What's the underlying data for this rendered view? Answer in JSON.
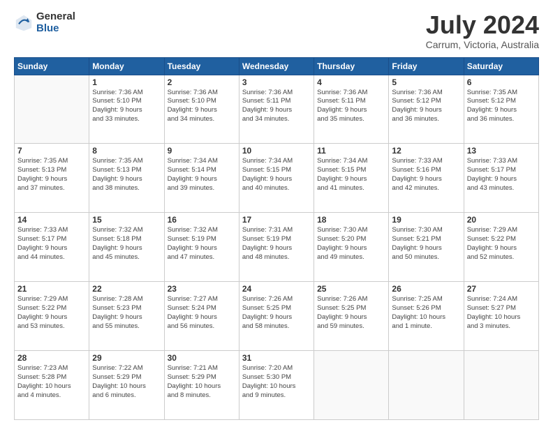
{
  "header": {
    "logo_general": "General",
    "logo_blue": "Blue",
    "title": "July 2024",
    "location": "Carrum, Victoria, Australia"
  },
  "weekdays": [
    "Sunday",
    "Monday",
    "Tuesday",
    "Wednesday",
    "Thursday",
    "Friday",
    "Saturday"
  ],
  "weeks": [
    [
      {
        "day": "",
        "info": ""
      },
      {
        "day": "1",
        "info": "Sunrise: 7:36 AM\nSunset: 5:10 PM\nDaylight: 9 hours\nand 33 minutes."
      },
      {
        "day": "2",
        "info": "Sunrise: 7:36 AM\nSunset: 5:10 PM\nDaylight: 9 hours\nand 34 minutes."
      },
      {
        "day": "3",
        "info": "Sunrise: 7:36 AM\nSunset: 5:11 PM\nDaylight: 9 hours\nand 34 minutes."
      },
      {
        "day": "4",
        "info": "Sunrise: 7:36 AM\nSunset: 5:11 PM\nDaylight: 9 hours\nand 35 minutes."
      },
      {
        "day": "5",
        "info": "Sunrise: 7:36 AM\nSunset: 5:12 PM\nDaylight: 9 hours\nand 36 minutes."
      },
      {
        "day": "6",
        "info": "Sunrise: 7:35 AM\nSunset: 5:12 PM\nDaylight: 9 hours\nand 36 minutes."
      }
    ],
    [
      {
        "day": "7",
        "info": "Sunrise: 7:35 AM\nSunset: 5:13 PM\nDaylight: 9 hours\nand 37 minutes."
      },
      {
        "day": "8",
        "info": "Sunrise: 7:35 AM\nSunset: 5:13 PM\nDaylight: 9 hours\nand 38 minutes."
      },
      {
        "day": "9",
        "info": "Sunrise: 7:34 AM\nSunset: 5:14 PM\nDaylight: 9 hours\nand 39 minutes."
      },
      {
        "day": "10",
        "info": "Sunrise: 7:34 AM\nSunset: 5:15 PM\nDaylight: 9 hours\nand 40 minutes."
      },
      {
        "day": "11",
        "info": "Sunrise: 7:34 AM\nSunset: 5:15 PM\nDaylight: 9 hours\nand 41 minutes."
      },
      {
        "day": "12",
        "info": "Sunrise: 7:33 AM\nSunset: 5:16 PM\nDaylight: 9 hours\nand 42 minutes."
      },
      {
        "day": "13",
        "info": "Sunrise: 7:33 AM\nSunset: 5:17 PM\nDaylight: 9 hours\nand 43 minutes."
      }
    ],
    [
      {
        "day": "14",
        "info": "Sunrise: 7:33 AM\nSunset: 5:17 PM\nDaylight: 9 hours\nand 44 minutes."
      },
      {
        "day": "15",
        "info": "Sunrise: 7:32 AM\nSunset: 5:18 PM\nDaylight: 9 hours\nand 45 minutes."
      },
      {
        "day": "16",
        "info": "Sunrise: 7:32 AM\nSunset: 5:19 PM\nDaylight: 9 hours\nand 47 minutes."
      },
      {
        "day": "17",
        "info": "Sunrise: 7:31 AM\nSunset: 5:19 PM\nDaylight: 9 hours\nand 48 minutes."
      },
      {
        "day": "18",
        "info": "Sunrise: 7:30 AM\nSunset: 5:20 PM\nDaylight: 9 hours\nand 49 minutes."
      },
      {
        "day": "19",
        "info": "Sunrise: 7:30 AM\nSunset: 5:21 PM\nDaylight: 9 hours\nand 50 minutes."
      },
      {
        "day": "20",
        "info": "Sunrise: 7:29 AM\nSunset: 5:22 PM\nDaylight: 9 hours\nand 52 minutes."
      }
    ],
    [
      {
        "day": "21",
        "info": "Sunrise: 7:29 AM\nSunset: 5:22 PM\nDaylight: 9 hours\nand 53 minutes."
      },
      {
        "day": "22",
        "info": "Sunrise: 7:28 AM\nSunset: 5:23 PM\nDaylight: 9 hours\nand 55 minutes."
      },
      {
        "day": "23",
        "info": "Sunrise: 7:27 AM\nSunset: 5:24 PM\nDaylight: 9 hours\nand 56 minutes."
      },
      {
        "day": "24",
        "info": "Sunrise: 7:26 AM\nSunset: 5:25 PM\nDaylight: 9 hours\nand 58 minutes."
      },
      {
        "day": "25",
        "info": "Sunrise: 7:26 AM\nSunset: 5:25 PM\nDaylight: 9 hours\nand 59 minutes."
      },
      {
        "day": "26",
        "info": "Sunrise: 7:25 AM\nSunset: 5:26 PM\nDaylight: 10 hours\nand 1 minute."
      },
      {
        "day": "27",
        "info": "Sunrise: 7:24 AM\nSunset: 5:27 PM\nDaylight: 10 hours\nand 3 minutes."
      }
    ],
    [
      {
        "day": "28",
        "info": "Sunrise: 7:23 AM\nSunset: 5:28 PM\nDaylight: 10 hours\nand 4 minutes."
      },
      {
        "day": "29",
        "info": "Sunrise: 7:22 AM\nSunset: 5:29 PM\nDaylight: 10 hours\nand 6 minutes."
      },
      {
        "day": "30",
        "info": "Sunrise: 7:21 AM\nSunset: 5:29 PM\nDaylight: 10 hours\nand 8 minutes."
      },
      {
        "day": "31",
        "info": "Sunrise: 7:20 AM\nSunset: 5:30 PM\nDaylight: 10 hours\nand 9 minutes."
      },
      {
        "day": "",
        "info": ""
      },
      {
        "day": "",
        "info": ""
      },
      {
        "day": "",
        "info": ""
      }
    ]
  ]
}
